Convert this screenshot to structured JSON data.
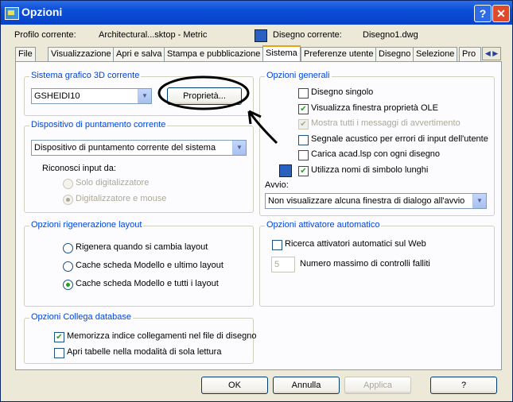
{
  "window": {
    "title": "Opzioni"
  },
  "header": {
    "profile_label": "Profilo corrente:",
    "profile_value": "Architectural...sktop - Metric",
    "drawing_label": "Disegno corrente:",
    "drawing_value": "Disegno1.dwg"
  },
  "tabs": [
    "File",
    "Visualizzazione",
    "Apri e salva",
    "Stampa e pubblicazione",
    "Sistema",
    "Preferenze utente",
    "Disegno",
    "Selezione",
    "Pro"
  ],
  "active_tab": "Sistema",
  "graphics3d": {
    "title": "Sistema grafico 3D corrente",
    "selected": "GSHEIDI10",
    "properties_button": "Proprietà..."
  },
  "pointing": {
    "title": "Dispositivo di puntamento corrente",
    "selected": "Dispositivo di puntamento corrente del sistema",
    "accept_label": "Riconosci input da:",
    "options": [
      {
        "label": "Solo digitalizzatore",
        "checked": false
      },
      {
        "label": "Digitalizzatore e mouse",
        "checked": true
      }
    ]
  },
  "regen": {
    "title": "Opzioni rigenerazione layout",
    "options": [
      {
        "label": "Rigenera quando si cambia layout",
        "checked": false
      },
      {
        "label": "Cache scheda Modello e ultimo layout",
        "checked": false
      },
      {
        "label": "Cache scheda Modello e tutti i layout",
        "checked": true
      }
    ]
  },
  "dbconnect": {
    "title": "Opzioni Collega database",
    "options": [
      {
        "label": "Memorizza indice collegamenti nel file di disegno",
        "checked": true
      },
      {
        "label": "Apri tabelle nella modalità di sola lettura",
        "checked": false
      }
    ]
  },
  "general": {
    "title": "Opzioni generali",
    "options": [
      {
        "label": "Disegno singolo",
        "checked": false,
        "disabled": false
      },
      {
        "label": "Visualizza finestra proprietà OLE",
        "checked": true,
        "disabled": false
      },
      {
        "label": "Mostra tutti i messaggi di avvertimento",
        "checked": true,
        "disabled": true
      },
      {
        "label": "Segnale acustico per errori di input dell'utente",
        "checked": false,
        "disabled": false
      },
      {
        "label": "Carica acad.lsp con ogni disegno",
        "checked": false,
        "disabled": false
      },
      {
        "label": "Utilizza nomi di simbolo lunghi",
        "checked": true,
        "disabled": false
      }
    ],
    "startup_label": "Avvio:",
    "startup_selected": "Non visualizzare alcuna finestra di dialogo all'avvio"
  },
  "autopublish": {
    "title": "Opzioni attivatore automatico",
    "web_label": "Ricerca attivatori automatici sul Web",
    "web_checked": false,
    "max_value": "5",
    "max_label": "Numero massimo di controlli falliti"
  },
  "footer": {
    "ok": "OK",
    "cancel": "Annulla",
    "apply": "Applica",
    "help": "?"
  },
  "icons": {
    "app": "autocad-icon",
    "drawing": "drawing-file-icon",
    "help": "help-icon",
    "close": "close-icon"
  },
  "colors": {
    "titlebar": "#0a4ed8",
    "group_title": "#0046d5",
    "check": "#21a121",
    "annotation": "#000000"
  }
}
